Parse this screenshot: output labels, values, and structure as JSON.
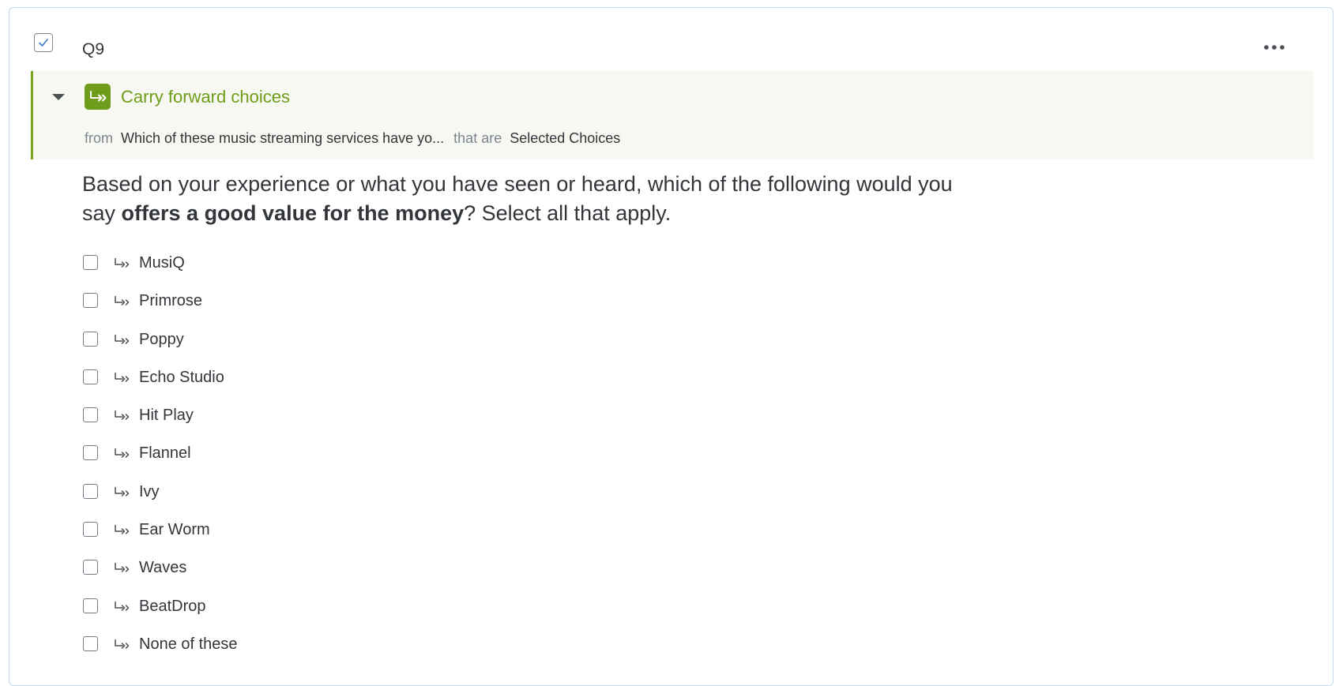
{
  "question": {
    "id": "Q9",
    "text_part1": "Based on your experience or what you have seen or heard, which of the following would you say ",
    "text_bold": "offers a good value for the money",
    "text_part2": "? Select all that apply."
  },
  "carry_forward": {
    "title": "Carry forward choices",
    "from_label": "from",
    "source_question": "Which of these music streaming services have yo...",
    "that_are_label": "that are",
    "filter": "Selected Choices",
    "accent_color": "#6f9c1a"
  },
  "choices": [
    {
      "label": "MusiQ"
    },
    {
      "label": "Primrose"
    },
    {
      "label": "Poppy"
    },
    {
      "label": "Echo Studio"
    },
    {
      "label": "Hit Play"
    },
    {
      "label": "Flannel"
    },
    {
      "label": "Ivy"
    },
    {
      "label": "Ear Worm"
    },
    {
      "label": "Waves"
    },
    {
      "label": "BeatDrop"
    },
    {
      "label": "None of these"
    }
  ],
  "icons": {
    "select_checkbox": "checkmark-icon",
    "more": "more-options-icon",
    "collapse": "caret-down-icon",
    "carry": "carry-forward-icon"
  }
}
